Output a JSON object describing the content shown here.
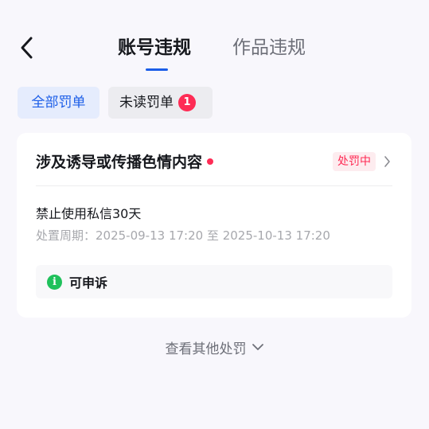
{
  "header": {
    "back_icon": "chevron-left-icon",
    "tabs": [
      {
        "label": "账号违规",
        "active": true
      },
      {
        "label": "作品违规",
        "active": false
      }
    ]
  },
  "filters": {
    "all_label": "全部罚单",
    "unread_label": "未读罚单",
    "unread_count": "1"
  },
  "violation": {
    "title": "涉及诱导或传播色情内容",
    "status": "处罚中",
    "punishment": "禁止使用私信30天",
    "period": "处置周期：2025-09-13 17:20 至 2025-10-13 17:20",
    "appeal_icon": "info-icon",
    "appeal_glyph": "i",
    "appeal_label": "可申诉"
  },
  "footer": {
    "more_label": "查看其他处罚"
  },
  "colors": {
    "accent": "#1c5ee8",
    "alert": "#fe2c55",
    "success": "#1fc15b"
  }
}
